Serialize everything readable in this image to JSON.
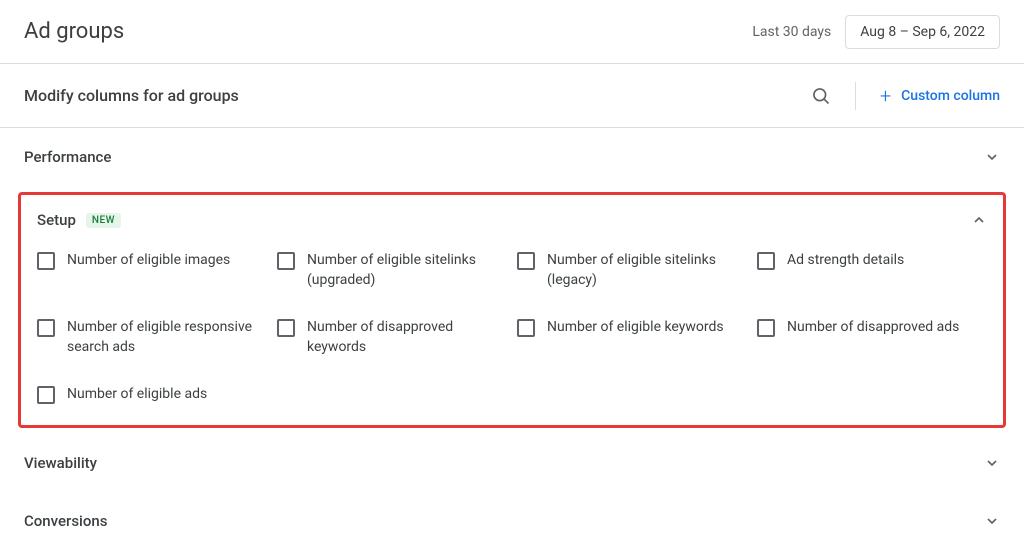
{
  "header": {
    "title": "Ad groups",
    "date_range_label": "Last 30 days",
    "date_range_value": "Aug 8 – Sep 6, 2022"
  },
  "subheader": {
    "title": "Modify columns for ad groups",
    "custom_column_label": "Custom column"
  },
  "sections": {
    "performance": {
      "title": "Performance"
    },
    "setup": {
      "title": "Setup",
      "badge": "NEW"
    },
    "viewability": {
      "title": "Viewability"
    },
    "conversions": {
      "title": "Conversions"
    }
  },
  "setup_columns": [
    "Number of eligible images",
    "Number of eligible sitelinks (upgraded)",
    "Number of eligible sitelinks (legacy)",
    "Ad strength details",
    "Number of eligible responsive search ads",
    "Number of disapproved keywords",
    "Number of eligible keywords",
    "Number of disapproved ads",
    "Number of eligible ads"
  ]
}
